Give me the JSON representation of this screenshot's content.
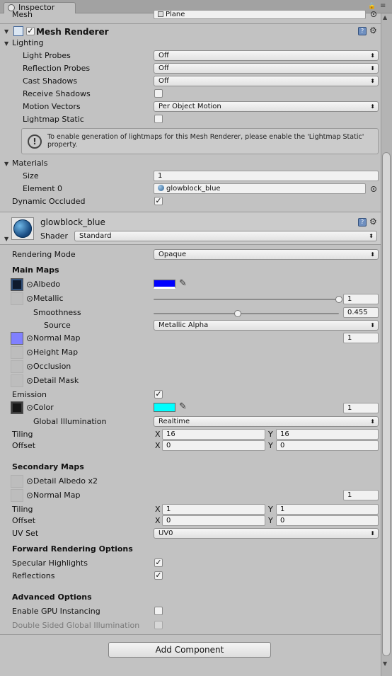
{
  "tab": {
    "title": "Inspector"
  },
  "mesh_row": {
    "label": "Mesh",
    "value": "Plane"
  },
  "mesh_renderer": {
    "title": "Mesh Renderer",
    "lighting": {
      "header": "Lighting",
      "rows": [
        {
          "label": "Light Probes",
          "value": "Off"
        },
        {
          "label": "Reflection Probes",
          "value": "Off"
        },
        {
          "label": "Cast Shadows",
          "value": "Off"
        },
        {
          "label": "Receive Shadows"
        },
        {
          "label": "Motion Vectors",
          "value": "Per Object Motion"
        },
        {
          "label": "Lightmap Static"
        }
      ],
      "help": "To enable generation of lightmaps for this Mesh Renderer, please enable the 'Lightmap Static' property."
    },
    "materials": {
      "header": "Materials",
      "size_label": "Size",
      "size_value": "1",
      "element_label": "Element 0",
      "element_value": "glowblock_blue"
    },
    "dynamic_occluded": {
      "label": "Dynamic Occluded",
      "checked": true
    }
  },
  "material": {
    "name": "glowblock_blue",
    "shader_label": "Shader",
    "shader_value": "Standard",
    "rendering_mode": {
      "label": "Rendering Mode",
      "value": "Opaque"
    },
    "main_maps": {
      "header": "Main Maps",
      "albedo": {
        "label": "Albedo",
        "color": "#0000ff"
      },
      "metallic": {
        "label": "Metallic",
        "value": "1",
        "level": 1.0
      },
      "smoothness": {
        "label": "Smoothness",
        "value": "0.455",
        "level": 0.455
      },
      "source": {
        "label": "Source",
        "value": "Metallic Alpha"
      },
      "normal_map": {
        "label": "Normal Map",
        "value": "1"
      },
      "height_map": {
        "label": "Height Map"
      },
      "occlusion": {
        "label": "Occlusion"
      },
      "detail_mask": {
        "label": "Detail Mask"
      },
      "emission": {
        "label": "Emission",
        "checked": true
      },
      "color": {
        "label": "Color",
        "swatch": "#00ffff",
        "value": "1"
      },
      "gi": {
        "label": "Global Illumination",
        "value": "Realtime"
      },
      "tiling": {
        "label": "Tiling",
        "x": "16",
        "y": "16"
      },
      "offset": {
        "label": "Offset",
        "x": "0",
        "y": "0"
      }
    },
    "secondary_maps": {
      "header": "Secondary Maps",
      "detail_albedo": {
        "label": "Detail Albedo x2"
      },
      "normal_map": {
        "label": "Normal Map",
        "value": "1"
      },
      "tiling": {
        "label": "Tiling",
        "x": "1",
        "y": "1"
      },
      "offset": {
        "label": "Offset",
        "x": "0",
        "y": "0"
      },
      "uv_set": {
        "label": "UV Set",
        "value": "UV0"
      }
    },
    "forward": {
      "header": "Forward Rendering Options",
      "specular": {
        "label": "Specular Highlights",
        "checked": true
      },
      "reflections": {
        "label": "Reflections",
        "checked": true
      }
    },
    "advanced": {
      "header": "Advanced Options",
      "gpu": {
        "label": "Enable GPU Instancing",
        "checked": false
      },
      "double_sided": {
        "label": "Double Sided Global Illumination",
        "checked": false
      }
    }
  },
  "axis": {
    "x": "X",
    "y": "Y"
  },
  "add_component": "Add Component",
  "colors": {
    "panel": "#c2c2c2",
    "accent_blue": "#0000ff",
    "accent_cyan": "#00ffff"
  }
}
